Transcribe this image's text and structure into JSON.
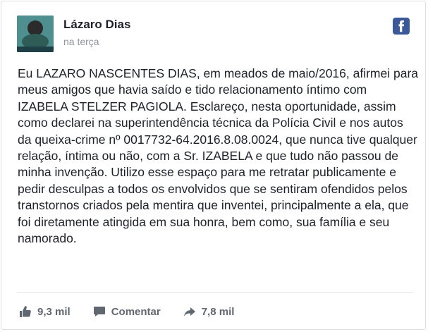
{
  "post": {
    "author": "Lázaro Dias",
    "timestamp": "na terça",
    "text": "Eu LAZARO NASCENTES DIAS, em meados de maio/2016, afirmei para meus amigos que havia saído e tido relacionamento íntimo com IZABELA STELZER PAGIOLA. Esclareço, nesta oportunidade, assim como declarei na superintendência técnica da Polícia Civil e nos autos da queixa-crime nº 0017732-64.2016.8.08.0024, que nunca tive qualquer relação, íntima ou não, com a Sr. IZABELA e que tudo não passou de minha invenção. Utilizo esse espaço para me retratar publicamente e pedir desculpas a todos os envolvidos que se sentiram ofendidos pelos transtornos criados pela mentira que inventei, principalmente a ela, que foi diretamente atingida em sua honra, bem como, sua família e seu namorado."
  },
  "actions": {
    "like_count": "9,3 mil",
    "comment_label": "Comentar",
    "share_count": "7,8 mil"
  },
  "icons": {
    "brand": "facebook-icon",
    "like": "thumbs-up-icon",
    "comment": "comment-bubble-icon",
    "share": "share-arrow-icon"
  },
  "colors": {
    "brand": "#3b5998",
    "text": "#1d2129",
    "muted": "#90949c",
    "action": "#606770"
  }
}
